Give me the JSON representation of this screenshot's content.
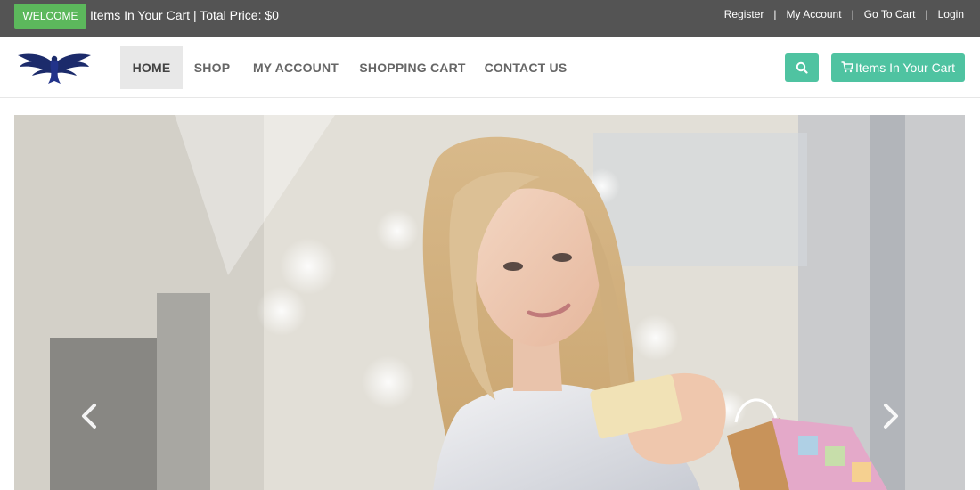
{
  "topbar": {
    "welcome_label": "WELCOME",
    "cart_summary": "Items In Your Cart | Total Price: $0",
    "links": {
      "register": "Register",
      "my_account": "My Account",
      "go_to_cart": "Go To Cart",
      "login": "Login",
      "separator": "|"
    }
  },
  "nav": {
    "home": "HOME",
    "shop": "SHOP",
    "my_account": "MY ACCOUNT",
    "shopping_cart": "SHOPPING CART",
    "contact_us": "CONTACT US",
    "cart_button": "Items In Your Cart"
  },
  "icons": {
    "search": "search-icon",
    "cart": "shopping-cart-icon",
    "logo": "eagle-logo-icon",
    "prev": "chevron-left-icon",
    "next": "chevron-right-icon"
  },
  "colors": {
    "topbar": "#545454",
    "welcome": "#5cb85c",
    "accent": "#4fc3a1",
    "nav_active": "#e8e8e8",
    "logo": "#1c2b6b"
  }
}
